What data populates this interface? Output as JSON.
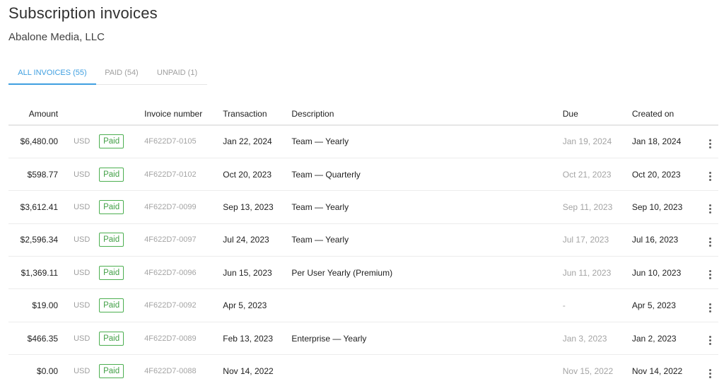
{
  "page": {
    "title": "Subscription invoices",
    "subtitle": "Abalone Media, LLC"
  },
  "tabs": [
    {
      "label": "ALL INVOICES (55)",
      "active": true
    },
    {
      "label": "PAID (54)",
      "active": false
    },
    {
      "label": "UNPAID (1)",
      "active": false
    }
  ],
  "table": {
    "headers": {
      "amount": "Amount",
      "invoice_number": "Invoice number",
      "transaction": "Transaction",
      "description": "Description",
      "due": "Due",
      "created_on": "Created on"
    },
    "rows": [
      {
        "amount": "$6,480.00",
        "currency": "USD",
        "status": "Paid",
        "invoice": "4F622D7-0105",
        "transaction": "Jan 22, 2024",
        "description": "Team — Yearly",
        "due": "Jan 19, 2024",
        "created": "Jan 18, 2024"
      },
      {
        "amount": "$598.77",
        "currency": "USD",
        "status": "Paid",
        "invoice": "4F622D7-0102",
        "transaction": "Oct 20, 2023",
        "description": "Team — Quarterly",
        "due": "Oct 21, 2023",
        "created": "Oct 20, 2023"
      },
      {
        "amount": "$3,612.41",
        "currency": "USD",
        "status": "Paid",
        "invoice": "4F622D7-0099",
        "transaction": "Sep 13, 2023",
        "description": "Team — Yearly",
        "due": "Sep 11, 2023",
        "created": "Sep 10, 2023"
      },
      {
        "amount": "$2,596.34",
        "currency": "USD",
        "status": "Paid",
        "invoice": "4F622D7-0097",
        "transaction": "Jul 24, 2023",
        "description": "Team — Yearly",
        "due": "Jul 17, 2023",
        "created": "Jul 16, 2023"
      },
      {
        "amount": "$1,369.11",
        "currency": "USD",
        "status": "Paid",
        "invoice": "4F622D7-0096",
        "transaction": "Jun 15, 2023",
        "description": "Per User Yearly (Premium)",
        "due": "Jun 11, 2023",
        "created": "Jun 10, 2023"
      },
      {
        "amount": "$19.00",
        "currency": "USD",
        "status": "Paid",
        "invoice": "4F622D7-0092",
        "transaction": "Apr 5, 2023",
        "description": "",
        "due": "-",
        "created": "Apr 5, 2023"
      },
      {
        "amount": "$466.35",
        "currency": "USD",
        "status": "Paid",
        "invoice": "4F622D7-0089",
        "transaction": "Feb 13, 2023",
        "description": "Enterprise — Yearly",
        "due": "Jan 3, 2023",
        "created": "Jan 2, 2023"
      },
      {
        "amount": "$0.00",
        "currency": "USD",
        "status": "Paid",
        "invoice": "4F622D7-0088",
        "transaction": "Nov 14, 2022",
        "description": "",
        "due": "Nov 15, 2022",
        "created": "Nov 14, 2022"
      }
    ],
    "row_menu_icon": "more-vertical-icon"
  },
  "colors": {
    "accent": "#3f9fe0",
    "paid_badge": "#43a047",
    "muted_text": "#a4a4a4"
  }
}
